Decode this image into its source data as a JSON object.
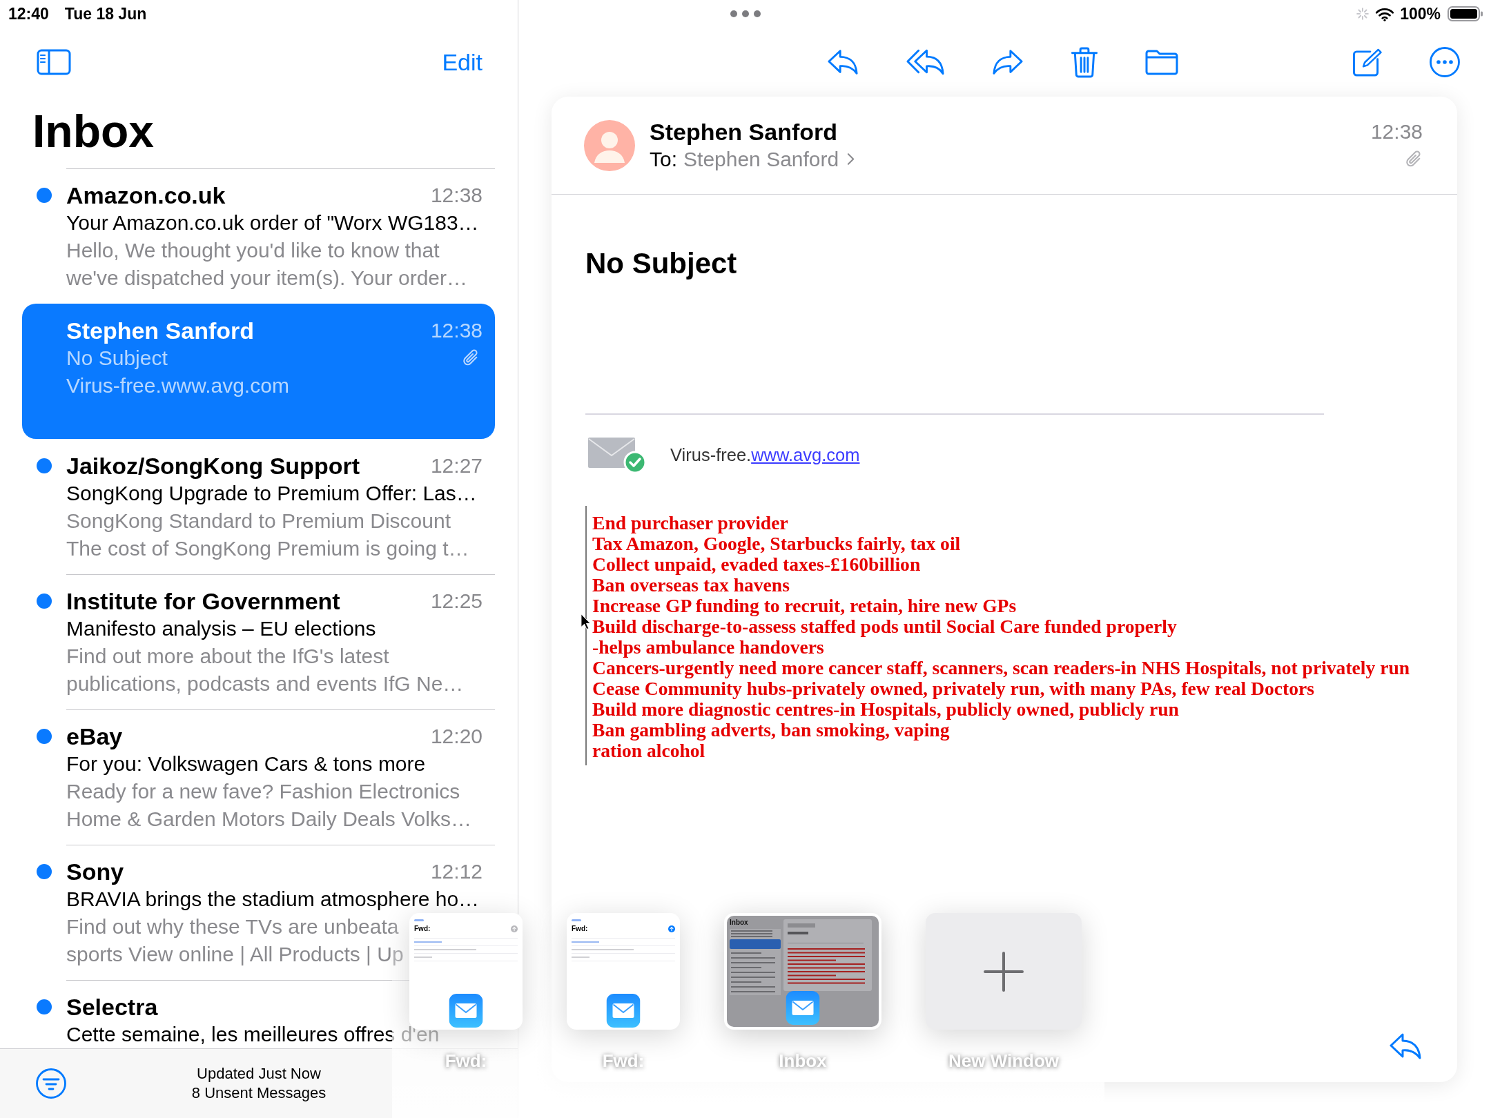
{
  "status_bar": {
    "time": "12:40",
    "date": "Tue 18 Jun",
    "battery_percent": "100%"
  },
  "sidebar": {
    "edit_label": "Edit",
    "title": "Inbox",
    "messages": [
      {
        "sender": "Amazon.co.uk",
        "time": "12:38",
        "subject": "Your Amazon.co.uk order of \"Worx WG183…",
        "preview_lines": [
          "Hello, We thought you'd like to know that",
          "we've dispatched your item(s). Your order…"
        ],
        "unread": true,
        "selected": false,
        "attachment": false
      },
      {
        "sender": "Stephen Sanford",
        "time": "12:38",
        "subject": "No Subject",
        "preview_lines": [
          "Virus-free.www.avg.com"
        ],
        "unread": false,
        "selected": true,
        "attachment": true
      },
      {
        "sender": "Jaikoz/SongKong Support",
        "time": "12:27",
        "subject": "SongKong Upgrade to Premium Offer: Las…",
        "preview_lines": [
          "SongKong Standard to Premium Discount",
          "The cost of SongKong Premium is going t…"
        ],
        "unread": true,
        "selected": false,
        "attachment": false
      },
      {
        "sender": "Institute for Government",
        "time": "12:25",
        "subject": "Manifesto analysis – EU elections",
        "preview_lines": [
          "Find out more about the IfG's latest",
          "publications, podcasts and events IfG Ne…"
        ],
        "unread": true,
        "selected": false,
        "attachment": false
      },
      {
        "sender": "eBay",
        "time": "12:20",
        "subject": "For you: Volkswagen Cars & tons more",
        "preview_lines": [
          "Ready for a new fave? Fashion Electronics",
          "Home & Garden Motors Daily Deals Volks…"
        ],
        "unread": true,
        "selected": false,
        "attachment": false
      },
      {
        "sender": "Sony",
        "time": "12:12",
        "subject": "BRAVIA brings the stadium atmosphere ho…",
        "preview_lines": [
          "Find out why these TVs are unbeata",
          "sports View online | All Products | Up"
        ],
        "unread": true,
        "selected": false,
        "attachment": false
      },
      {
        "sender": "Selectra",
        "subject": "Cette semaine, les meilleures offres d'en",
        "unread": true,
        "selected": false,
        "attachment": false
      }
    ],
    "footer": {
      "status": "Updated Just Now",
      "unsent": "8 Unsent Messages"
    }
  },
  "message": {
    "sender": "Stephen Sanford",
    "to_label": "To:",
    "recipient": "Stephen Sanford",
    "time": "12:38",
    "attachment": true,
    "subject": "No Subject",
    "signature": {
      "text": "Virus-free.",
      "link": "www.avg.com"
    },
    "body_lines": [
      "End purchaser provider",
      "Tax Amazon, Google, Starbucks fairly, tax oil",
      "Collect unpaid, evaded taxes-£160billion",
      "Ban overseas tax havens",
      "Increase GP funding to recruit, retain, hire new GPs",
      "Build discharge-to-assess staffed pods until Social Care funded properly",
      "-helps ambulance handovers",
      "Cancers-urgently need more cancer staff, scanners, scan readers-in NHS Hospitals, not privately run",
      "Cease Community hubs-privately owned, privately run, with many PAs, few real Doctors",
      "Build more diagnostic centres-in Hospitals, publicly owned, publicly run",
      "Ban gambling adverts, ban smoking, vaping",
      "ration alcohol"
    ]
  },
  "window_shelf": {
    "windows": [
      {
        "kind": "compose",
        "title": "Fwd:",
        "label": "Fwd:",
        "selected": false,
        "send_enabled": false
      },
      {
        "kind": "compose",
        "title": "Fwd:",
        "label": "Fwd:",
        "selected": false,
        "send_enabled": true
      },
      {
        "kind": "inbox",
        "title": "Inbox",
        "label": "Inbox",
        "selected": true
      },
      {
        "kind": "new",
        "label": "New Window",
        "selected": false
      }
    ]
  }
}
